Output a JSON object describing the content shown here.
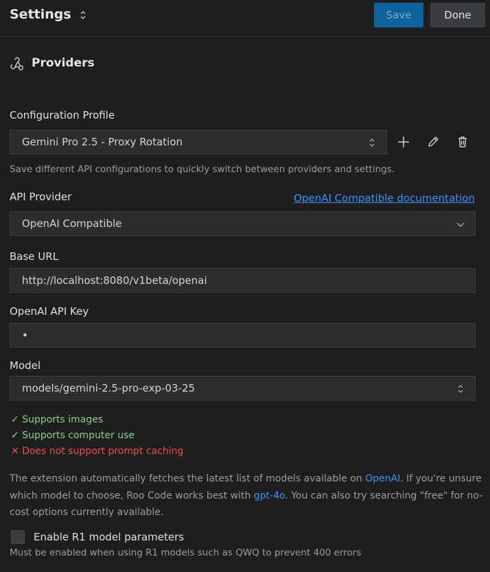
{
  "header": {
    "title": "Settings",
    "save_label": "Save",
    "done_label": "Done"
  },
  "section": {
    "title": "Providers",
    "icon": "webhook-icon"
  },
  "config_profile": {
    "label": "Configuration Profile",
    "selected": "Gemini Pro 2.5 - Proxy Rotation",
    "help": "Save different API configurations to quickly switch between providers and settings."
  },
  "api_provider": {
    "label": "API Provider",
    "doc_link": "OpenAI Compatible documentation",
    "selected": "OpenAI Compatible"
  },
  "base_url": {
    "label": "Base URL",
    "value": "http://localhost:8080/v1beta/openai"
  },
  "api_key": {
    "label": "OpenAI API Key",
    "value": "•"
  },
  "model": {
    "label": "Model",
    "selected": "models/gemini-2.5-pro-exp-03-25"
  },
  "capabilities": [
    {
      "mark": "✓",
      "text": "Supports images",
      "status": "ok"
    },
    {
      "mark": "✓",
      "text": "Supports computer use",
      "status": "ok"
    },
    {
      "mark": "✕",
      "text": "Does not support prompt caching",
      "status": "bad"
    }
  ],
  "info": {
    "part1": "The extension automatically fetches the latest list of models available on ",
    "link1": "OpenAI",
    "part2": ". If you're unsure which model to choose, Roo Code works best with ",
    "link2": "gpt-4o",
    "part3": ". You can also try searching \"free\" for no-cost options currently available."
  },
  "r1": {
    "label": "Enable R1 model parameters",
    "checked": false,
    "help": "Must be enabled when using R1 models such as QWQ to prevent 400 errors"
  },
  "colors": {
    "background": "#1e1e1e",
    "accent": "#0e639c",
    "link": "#3794ff",
    "success": "#89d185",
    "error": "#f14c4c"
  }
}
